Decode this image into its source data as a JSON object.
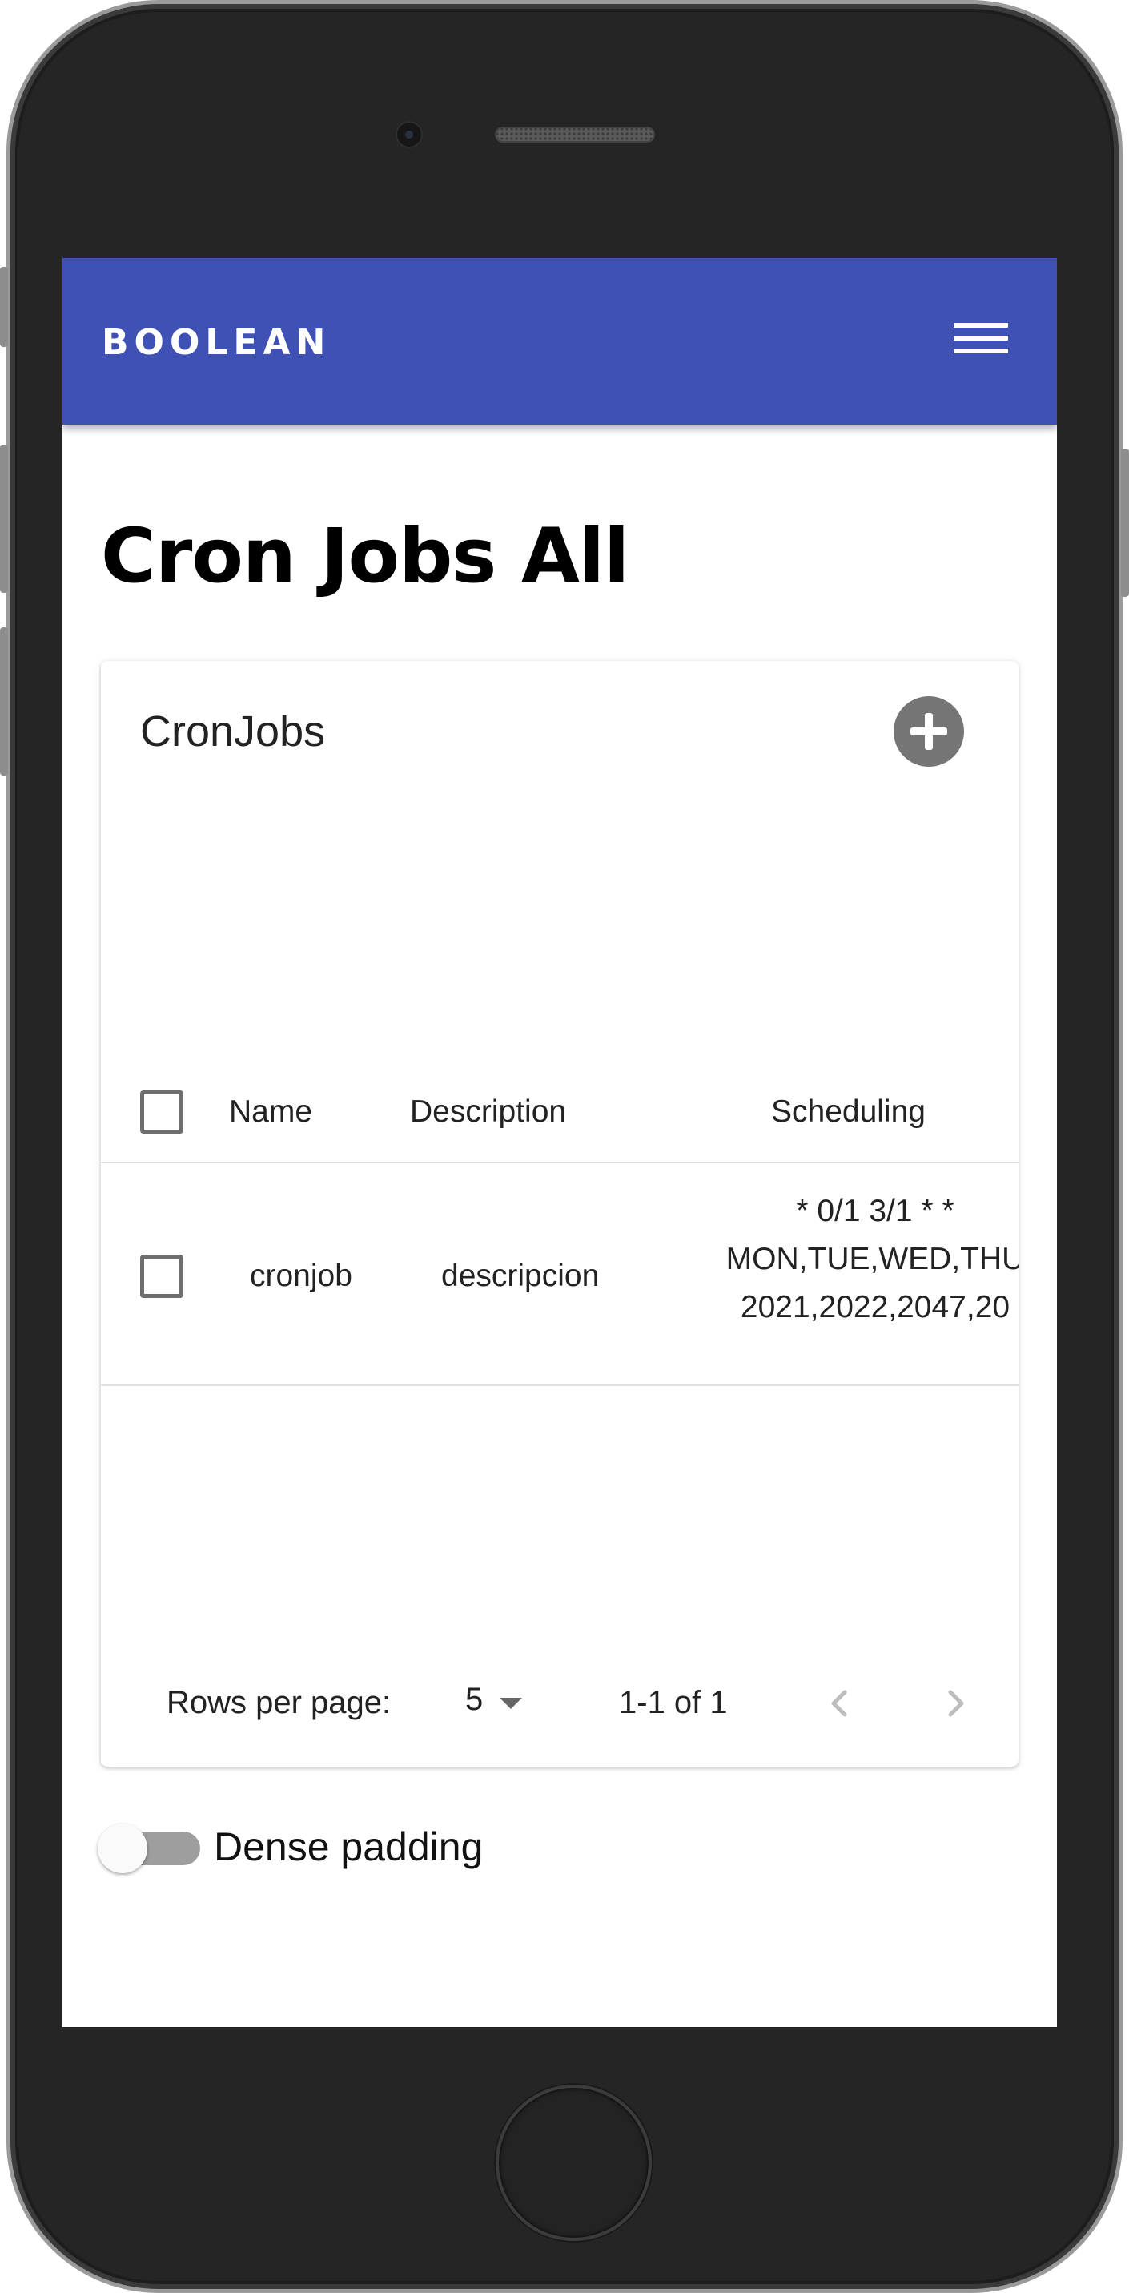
{
  "appbar": {
    "brand": "BOOLEAN",
    "color": "#3f51b5",
    "menu_icon": "hamburger-menu-icon"
  },
  "page": {
    "title": "Cron Jobs All"
  },
  "table": {
    "title": "CronJobs",
    "add_icon": "add-circle-icon",
    "columns": [
      "Name",
      "Description",
      "Scheduling"
    ],
    "rows": [
      {
        "selected": false,
        "name": "cronjob",
        "description": "descripcion",
        "scheduling_lines": [
          "* 0/1 3/1 * *",
          "MON,TUE,WED,THU",
          "2021,2022,2047,20"
        ]
      }
    ],
    "pagination": {
      "rows_per_page_label": "Rows per page:",
      "rows_per_page_value": "5",
      "range_text": "1-1 of 1",
      "prev_icon": "chevron-left-icon",
      "next_icon": "chevron-right-icon"
    }
  },
  "dense_padding": {
    "label": "Dense padding",
    "enabled": false
  }
}
